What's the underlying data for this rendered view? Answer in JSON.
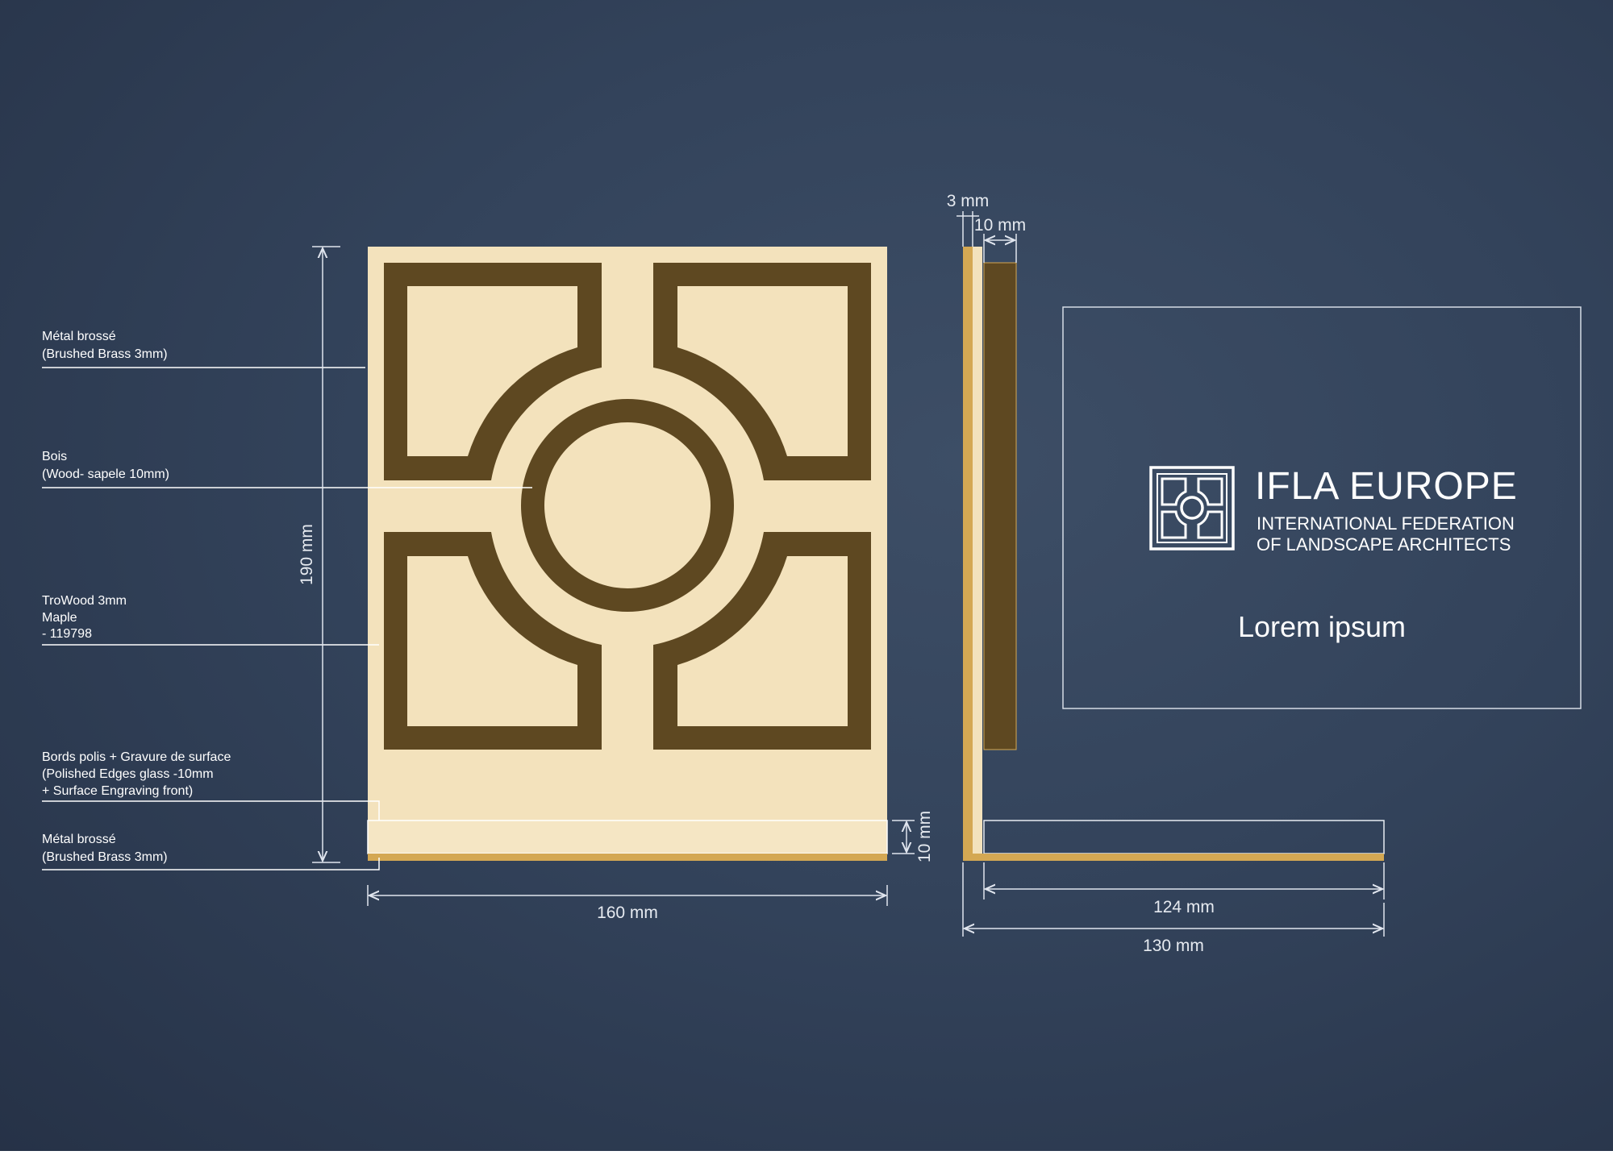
{
  "materials": {
    "brass_top": {
      "fr": "Métal brossé",
      "en": "(Brushed Brass 3mm)"
    },
    "wood": {
      "fr": "Bois",
      "en": "(Wood- sapele 10mm)"
    },
    "trowood": {
      "line1": "TroWood 3mm",
      "line2": "Maple",
      "line3": "- 119798"
    },
    "glass": {
      "fr": "Bords polis + Gravure de surface",
      "en1": "(Polished Edges glass -10mm",
      "en2": "+ Surface Engraving front)"
    },
    "brass_bottom": {
      "fr": "Métal brossé",
      "en": "(Brushed Brass 3mm)"
    }
  },
  "dimensions": {
    "height": "190 mm",
    "width": "160 mm",
    "base_height": "10 mm",
    "side_thickness": "3 mm",
    "wood_thickness": "10 mm",
    "depth_inner": "124 mm",
    "depth_outer": "130 mm"
  },
  "logo": {
    "title": "IFLA EUROPE",
    "subtitle_line1": "INTERNATIONAL FEDERATION",
    "subtitle_line2": "OF LANDSCAPE ARCHITECTS",
    "tagline": "Lorem ipsum"
  },
  "colors": {
    "background": "#33435b",
    "panel_fill": "#f3e2bc",
    "pattern_brown": "#5e4821",
    "brass": "#d4a853",
    "line_white": "#e8ecf2"
  }
}
